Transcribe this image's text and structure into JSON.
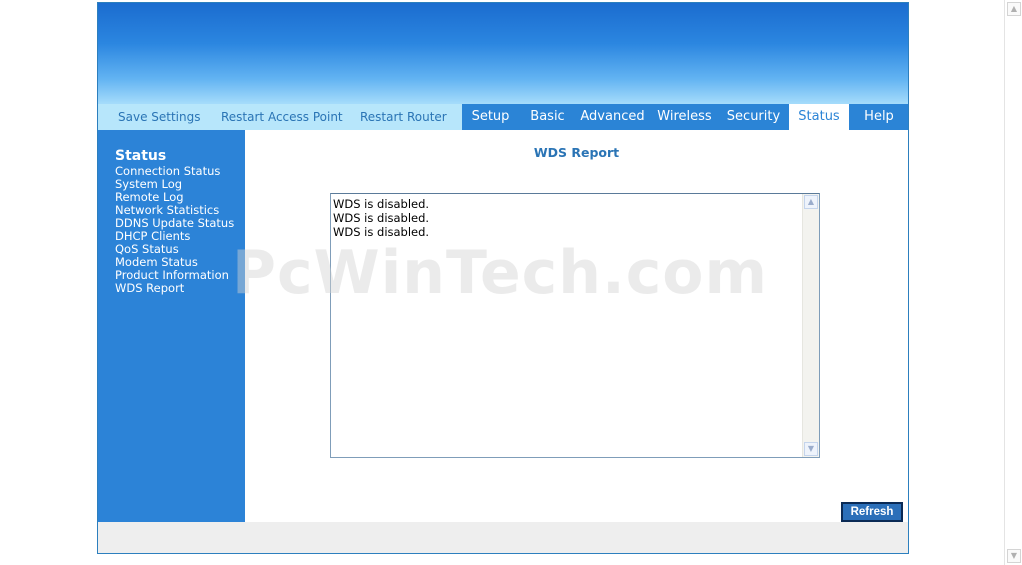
{
  "toolbar": {
    "save_settings": "Save Settings",
    "restart_access_point": "Restart Access Point",
    "restart_router": "Restart Router"
  },
  "tabs": [
    {
      "label": "Setup"
    },
    {
      "label": "Basic"
    },
    {
      "label": "Advanced"
    },
    {
      "label": "Wireless"
    },
    {
      "label": "Security"
    },
    {
      "label": "Status",
      "active": true
    },
    {
      "label": "Help"
    }
  ],
  "sidebar": {
    "title": "Status",
    "items": [
      {
        "label": "Connection Status"
      },
      {
        "label": "System Log"
      },
      {
        "label": "Remote Log"
      },
      {
        "label": "Network Statistics"
      },
      {
        "label": "DDNS Update Status"
      },
      {
        "label": "DHCP Clients"
      },
      {
        "label": "QoS Status"
      },
      {
        "label": "Modem Status"
      },
      {
        "label": "Product Information"
      },
      {
        "label": "WDS Report"
      }
    ]
  },
  "main": {
    "title": "WDS Report",
    "report_lines": [
      "WDS is disabled.",
      "WDS is disabled.",
      "WDS is disabled."
    ],
    "refresh_label": "Refresh"
  },
  "watermark": "PcWinTech.com",
  "icons": {
    "scroll_up": "chevron-up-icon",
    "scroll_down": "chevron-down-icon"
  },
  "colors": {
    "primary_blue": "#2c83d7",
    "light_bar": "#b7e6fb",
    "link_text": "#2a74b5"
  }
}
